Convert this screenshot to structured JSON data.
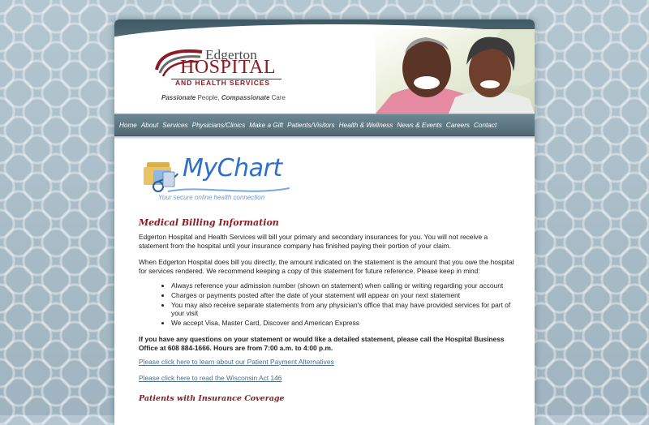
{
  "header": {
    "logo_name": "Edgerton",
    "logo_hospital": "HOSPITAL",
    "logo_sub": "AND HEALTH SERVICES",
    "tagline_word1": "Passionate",
    "tagline_mid": " People, ",
    "tagline_word2": "Compassionate",
    "tagline_end": " Care"
  },
  "nav": {
    "items": [
      "Home",
      "About",
      "Services",
      "Physicians/Clinics",
      "Make a Gift",
      "Patients/Visitors",
      "Health & Wellness",
      "News & Events",
      "Careers",
      "Contact"
    ]
  },
  "mychart": {
    "title": "MyChart",
    "slogan": "Your secure online health connection"
  },
  "content": {
    "heading": "Medical Billing Information",
    "para1": "Edgerton Hospital and Health Services will bill your primary and secondary insurances for you. You will not receive a statement from the hospital until your insurance company has finished paying their portion of your claim.",
    "para2": "When Edgerton Hospital does bill you directly, the amount indicated on the statement is the amount that you owe the hospital for services rendered. We recommend keeping a copy of this statement for future reference. Please keep in mind:",
    "bullets": [
      "Always reference your admission number (shown on statement) when calling or writing regarding your account",
      "Charges or payments posted after the date of your statement will appear on your next statement",
      "You may also receive separate statements from any physician's office that may have provided services for part of your visit",
      "We accept Visa, Master Card, Discover and American Express"
    ],
    "bold_note": "If you have any questions on your statement or would like a detailed statement, please call the Hospital Business Office at 608 884-1666. Hours are from 7:00 a.m. to 4:00 p.m.",
    "link1": "Please click here to learn about our Patient Payment Alternatives",
    "link2": "Please click here to read the Wisconsin Act 146",
    "subheading": "Patients with Insurance Coverage"
  }
}
